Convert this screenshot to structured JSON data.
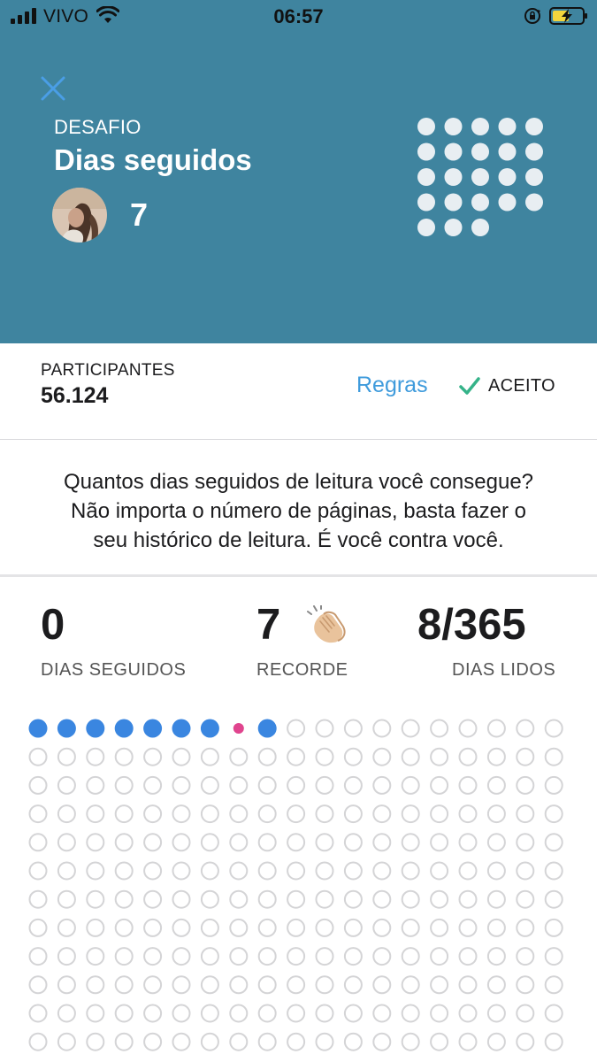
{
  "status_bar": {
    "carrier": "VIVO",
    "time": "06:57",
    "icons": [
      "cellular-signal-icon",
      "wifi-icon",
      "orientation-lock-icon",
      "battery-charging-icon"
    ]
  },
  "header": {
    "close_icon": "close-icon",
    "label": "DESAFIO",
    "title": "Dias seguidos",
    "participant_avatar_count": "7",
    "decoration_icon": "dot-pattern-icon",
    "background_color": "#3f849f"
  },
  "participants": {
    "label": "PARTICIPANTES",
    "count": "56.124",
    "rules_link": "Regras",
    "accepted_label": "ACEITO",
    "accepted_icon": "checkmark-icon",
    "accepted_color": "#35b389",
    "link_color": "#3f9bdc"
  },
  "description": {
    "lines": [
      "Quantos dias seguidos de leitura você consegue?",
      "Não importa o número de páginas, basta fazer o",
      "seu histórico de leitura. É você contra você."
    ]
  },
  "stats": [
    {
      "value": "0",
      "label": "DIAS SEGUIDOS"
    },
    {
      "value": "7",
      "label": "RECORDE",
      "icon": "clapping-hands-icon"
    },
    {
      "value": "8/365",
      "label": "DIAS LIDOS"
    }
  ],
  "calendar": {
    "columns": 19,
    "visible_rows": 12,
    "filled_color": "#3a86e0",
    "today_color": "#e0448e",
    "empty_color": "#d4d4d6",
    "first_row_states": [
      "read",
      "read",
      "read",
      "read",
      "read",
      "read",
      "read",
      "today",
      "read"
    ]
  }
}
